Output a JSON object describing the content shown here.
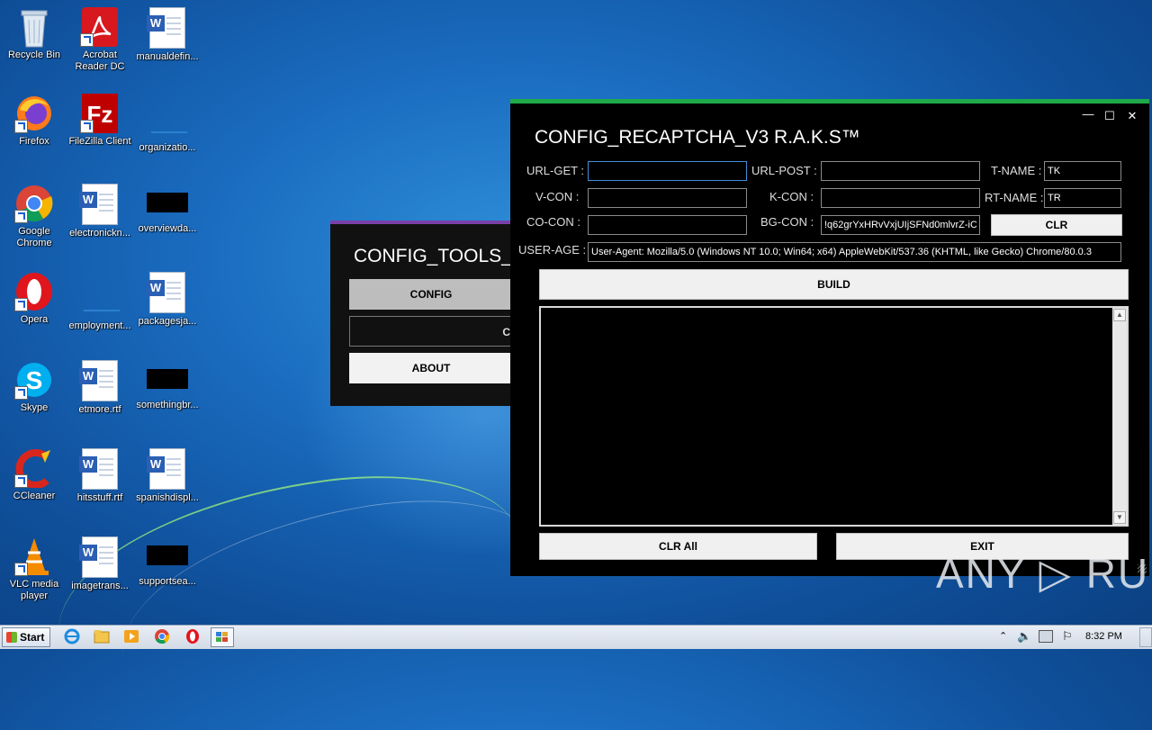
{
  "desktop": {
    "icons": [
      {
        "label": "Recycle Bin"
      },
      {
        "label": "Acrobat Reader DC"
      },
      {
        "label": "manualdefin..."
      },
      {
        "label": "Firefox"
      },
      {
        "label": "FileZilla Client"
      },
      {
        "label": "organizatio..."
      },
      {
        "label": "Google Chrome"
      },
      {
        "label": "electronickn..."
      },
      {
        "label": "overviewda..."
      },
      {
        "label": "Opera"
      },
      {
        "label": "employment..."
      },
      {
        "label": "packagesja..."
      },
      {
        "label": "Skype"
      },
      {
        "label": "etmore.rtf"
      },
      {
        "label": "somethingbr..."
      },
      {
        "label": "CCleaner"
      },
      {
        "label": "hitsstuff.rtf"
      },
      {
        "label": "spanishdispl..."
      },
      {
        "label": "VLC media player"
      },
      {
        "label": "imagetrans..."
      },
      {
        "label": "supportsea..."
      }
    ]
  },
  "tools_window": {
    "title": "CONFIG_TOOLS_",
    "buttons": {
      "config": "CONFIG",
      "second": "C",
      "about": "ABOUT"
    }
  },
  "main_window": {
    "title": "CONFIG_RECAPTCHA_V3 R.A.K.S™",
    "controls": {
      "minimize": "—",
      "maximize": "☐",
      "close": "✕"
    },
    "fields": {
      "url_get": {
        "label": "URL-GET :",
        "value": ""
      },
      "url_post": {
        "label": "URL-POST :",
        "value": ""
      },
      "t_name": {
        "label": "T-NAME :",
        "value": "TK"
      },
      "v_con": {
        "label": "V-CON :",
        "value": ""
      },
      "k_con": {
        "label": "K-CON :",
        "value": ""
      },
      "rt_name": {
        "label": "RT-NAME :",
        "value": "TR"
      },
      "co_con": {
        "label": "CO-CON :",
        "value": ""
      },
      "bg_con": {
        "label": "BG-CON :",
        "value": "!q62grYxHRvVxjUIjSFNd0mlvrZ-iC"
      },
      "user_age": {
        "label": "USER-AGE :",
        "value": "User-Agent: Mozilla/5.0 (Windows NT 10.0; Win64; x64) AppleWebKit/537.36 (KHTML, like Gecko) Chrome/80.0.3"
      }
    },
    "buttons": {
      "clr": "CLR",
      "build": "BUILD",
      "clr_all": "CLR All",
      "exit": "EXIT"
    },
    "output": {
      "value": ""
    }
  },
  "watermark": "ANY ▷ RUN",
  "taskbar": {
    "start_label": "Start",
    "clock": "8:32 PM"
  },
  "colors": {
    "accent_green": "#1faa4a",
    "tools_accent": "#7a3fa8",
    "window_bg": "#000000"
  }
}
